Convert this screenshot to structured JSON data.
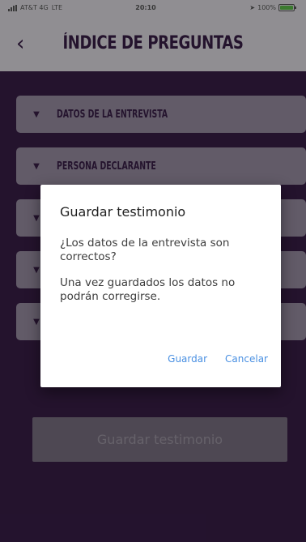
{
  "status_bar": {
    "carrier": "AT&T 4G",
    "network": "LTE",
    "time": "20:10",
    "battery": "100%",
    "battery_level": 1.0
  },
  "header": {
    "title": "ÍNDICE DE PREGUNTAS",
    "back_icon": "chevron-left-icon"
  },
  "accordion": {
    "items": [
      {
        "label": "DATOS DE LA ENTREVISTA"
      },
      {
        "label": "PERSONA DECLARANTE"
      },
      {
        "label": ""
      },
      {
        "label": ""
      },
      {
        "label": ""
      }
    ]
  },
  "main": {
    "save_button_label": "Guardar testimonio"
  },
  "dialog": {
    "title": "Guardar testimonio",
    "message_line1": "¿Los datos de la entrevista son correctos?",
    "message_line2": "Una vez guardados los datos no podrán corregirse.",
    "confirm_label": "Guardar",
    "cancel_label": "Cancelar"
  },
  "colors": {
    "background": "#3a1f4a",
    "header_bg": "#e9e6ec",
    "accordion_item": "#9e93a8",
    "dialog_action": "#4a90e2"
  }
}
